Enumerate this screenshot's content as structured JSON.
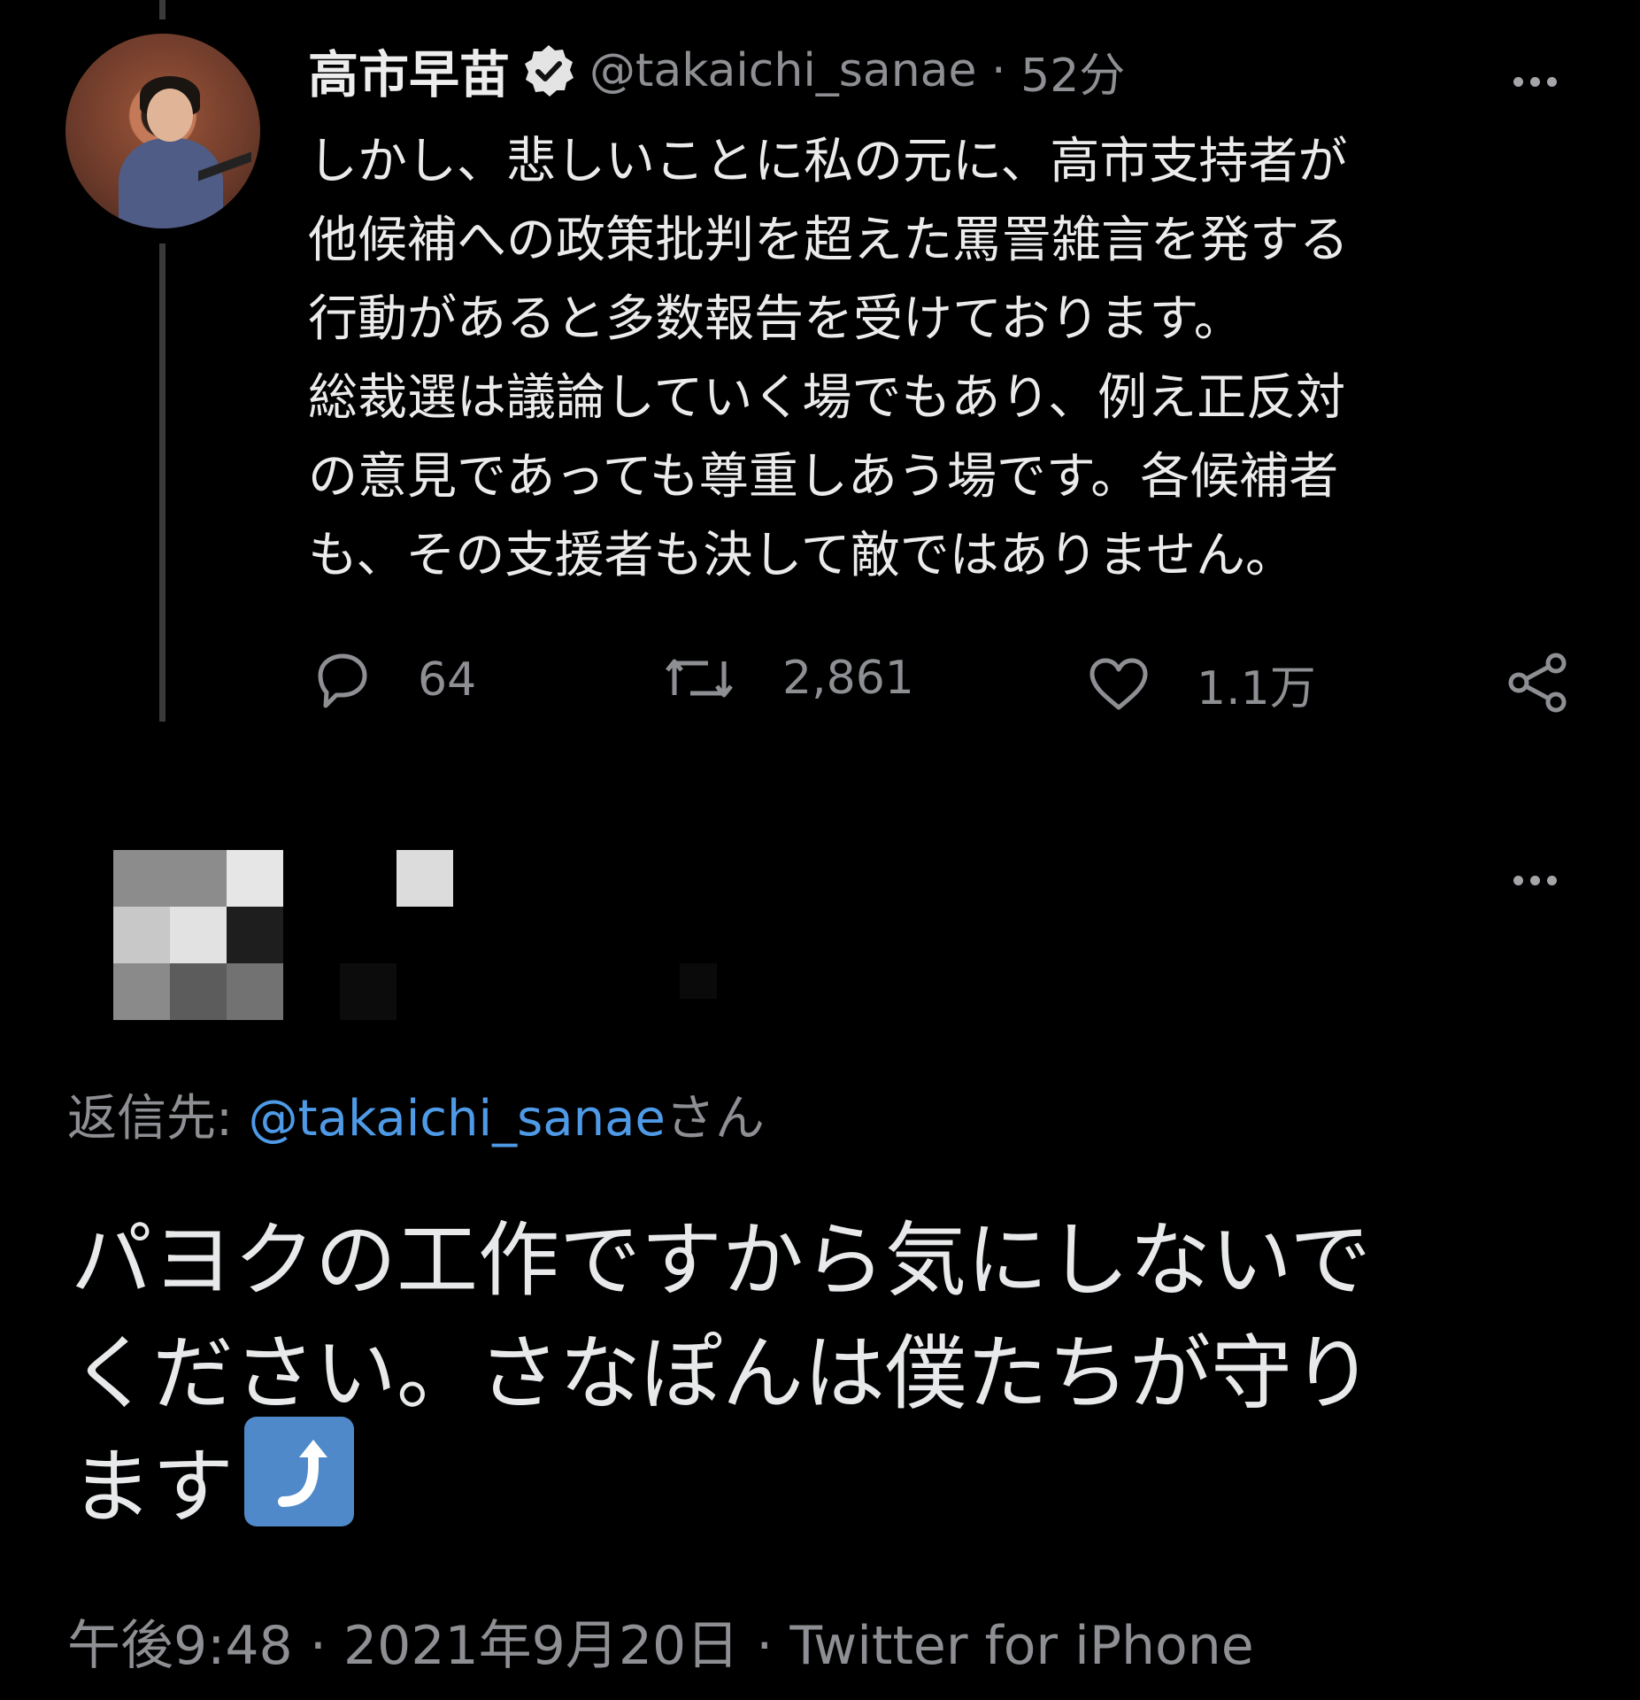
{
  "parent_tweet": {
    "author_name": "高市早苗",
    "handle": "@takaichi_sanae",
    "time": "52分",
    "text_lines": [
      "しかし、悲しいことに私の元に、高市支持者が",
      "他候補への政策批判を超えた罵詈雑言を発する",
      "行動があると多数報告を受けております。",
      "総裁選は議論していく場でもあり、例え正反対",
      "の意見であっても尊重しあう場です。各候補者",
      "も、その支援者も決して敵ではありません。"
    ],
    "replies": "64",
    "retweets": "2,861",
    "likes": "1.1万"
  },
  "reply_tweet": {
    "reply_to_prefix": "返信先: ",
    "reply_to_handle": "@takaichi_sanae",
    "reply_to_suffix": "さん",
    "text_lines": [
      "パヨクの工作ですから気にしないで",
      "ください。さなぽんは僕たちが守り",
      "ます"
    ],
    "emoji": "⤴",
    "time": "午後9:48",
    "date": "2021年9月20日",
    "client": "Twitter for iPhone"
  },
  "colors": {
    "background": "#000000",
    "text": "#e7e9ea",
    "muted": "#8d8f93",
    "link": "#4e9ae6",
    "emoji_bg": "#4f89c9"
  },
  "icons": [
    "verified-badge-icon",
    "more-icon",
    "reply-icon",
    "retweet-icon",
    "like-icon",
    "share-icon"
  ]
}
